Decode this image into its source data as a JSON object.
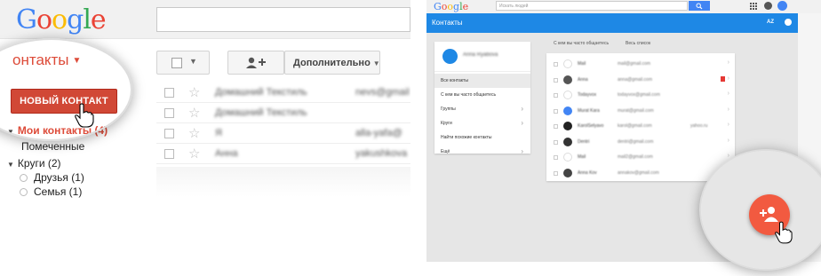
{
  "left": {
    "logo": "Google",
    "logo_colors": [
      "#4285f4",
      "#ea4335",
      "#fbbc05",
      "#4285f4",
      "#34a853",
      "#ea4335"
    ],
    "section_title": "онтакты",
    "more_button": "Дополнительно",
    "new_contact_button": "НОВЫЙ КОНТАКТ",
    "nav": {
      "my_contacts": "Мои контакты (4)",
      "starred": "Помеченные",
      "circles": "Круги (2)",
      "friends": "Друзья (1)",
      "family": "Семья (1)"
    },
    "rows": [
      {
        "name": "Домашний Текстиль",
        "email": "nevs@gmail"
      },
      {
        "name": "Домашний Текстиль",
        "email": ""
      },
      {
        "name": "Я",
        "email": "alla-yafa@"
      },
      {
        "name": "Анна",
        "email": "yakushkova"
      }
    ],
    "accent_color": "#dd4b39"
  },
  "right": {
    "logo": "Google",
    "search_placeholder": "Искать людей",
    "bar_title": "Контакты",
    "sort_label": "AZ",
    "user_name": "Anna Ryabova",
    "sidebar_items": [
      {
        "label": "Все контакты",
        "chevron": ""
      },
      {
        "label": "С кем вы часто общаетесь",
        "chevron": ""
      },
      {
        "label": "Группы",
        "chevron": "›"
      },
      {
        "label": "Круги",
        "chevron": "›"
      },
      {
        "label": "Найти похожие контакты",
        "chevron": ""
      },
      {
        "label": "Ещё",
        "chevron": "›"
      }
    ],
    "tab_frequent": "С кем вы часто общаетесь",
    "tab_all": "Весь список",
    "contact_rows": [
      {
        "name": "Mail",
        "email": "mail@gmail.com",
        "extra": "",
        "avatar": "#ffffff"
      },
      {
        "name": "Anna",
        "email": "anna@gmail.com",
        "extra": "",
        "avatar": "#555555"
      },
      {
        "name": "Todayvox",
        "email": "todayvox@gmail.com",
        "extra": "",
        "avatar": "#ffffff"
      },
      {
        "name": "Murat Kara",
        "email": "murat@gmail.com",
        "extra": "",
        "avatar": "#4285f4"
      },
      {
        "name": "KarolSelyavo",
        "email": "karol@gmail.com",
        "extra": "yahoo.ru",
        "avatar": "#222222"
      },
      {
        "name": "Dentri",
        "email": "dentri@gmail.com",
        "extra": "",
        "avatar": "#333333"
      },
      {
        "name": "Mail",
        "email": "mail2@gmail.com",
        "extra": "",
        "avatar": "#ffffff"
      },
      {
        "name": "Anna Kov",
        "email": "annakov@gmail.com",
        "extra": "",
        "avatar": "#444444"
      }
    ],
    "fab_color": "#f25a40",
    "bar_color": "#1e88e5"
  }
}
